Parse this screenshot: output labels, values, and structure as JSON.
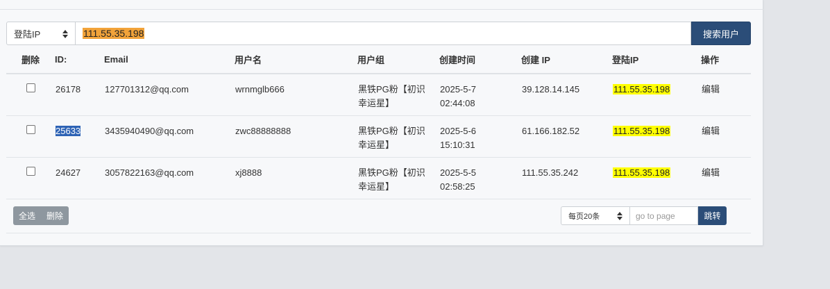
{
  "search": {
    "field_select": "登陆IP",
    "query": "111.55.35.198",
    "button_label": "搜索用户"
  },
  "table": {
    "headers": {
      "delete": "删除",
      "id": "ID:",
      "email": "Email",
      "username": "用户名",
      "group": "用户组",
      "created_time": "创建时间",
      "created_ip": "创建 IP",
      "login_ip": "登陆IP",
      "actions": "操作"
    },
    "rows": [
      {
        "id": "26178",
        "email": "127701312@qq.com",
        "username": "wrnmglb666",
        "group": "黑铁PG粉【初识幸运星】",
        "created_date": "2025-5-7",
        "created_clock": "02:44:08",
        "created_ip": "39.128.14.145",
        "login_ip": "111.55.35.198",
        "action": "编辑"
      },
      {
        "id": "25633",
        "email": "3435940490@qq.com",
        "username": "zwc88888888",
        "group": "黑铁PG粉【初识幸运星】",
        "created_date": "2025-5-6",
        "created_clock": "15:10:31",
        "created_ip": "61.166.182.52",
        "login_ip": "111.55.35.198",
        "action": "编辑"
      },
      {
        "id": "24627",
        "email": "3057822163@qq.com",
        "username": "xj8888",
        "group": "黑铁PG粉【初识幸运星】",
        "created_date": "2025-5-5",
        "created_clock": "02:58:25",
        "created_ip": "111.55.35.242",
        "login_ip": "111.55.35.198",
        "action": "编辑"
      }
    ]
  },
  "bulk": {
    "select_all": "全选",
    "delete": "删除"
  },
  "pager": {
    "per_page": "每页20条",
    "goto_placeholder": "go to page",
    "jump": "跳转"
  },
  "colors": {
    "primary_button": "#2b4d78",
    "search_highlight": "#f2a33a",
    "ip_highlight": "#ffff00",
    "selection": "#2e63b5",
    "link": "#2a5582"
  }
}
